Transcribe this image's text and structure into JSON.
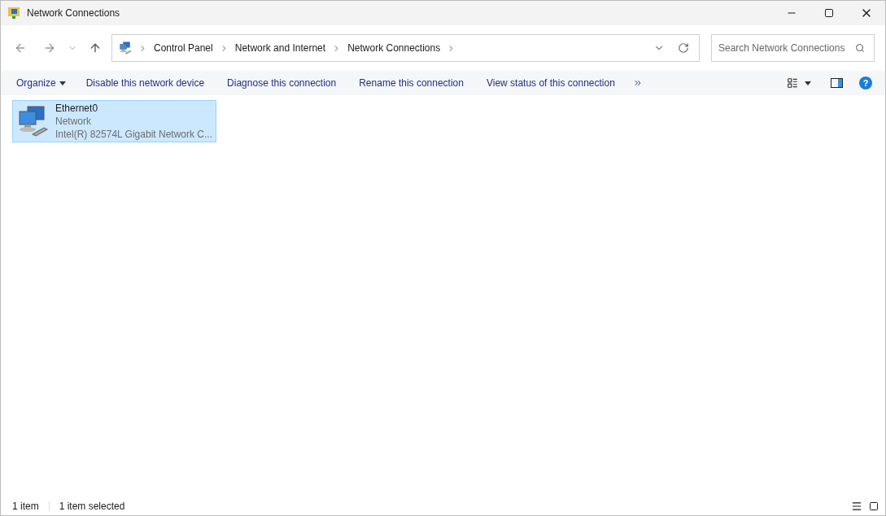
{
  "window": {
    "title": "Network Connections"
  },
  "address_bar": {
    "crumbs": [
      "Control Panel",
      "Network and Internet",
      "Network Connections"
    ]
  },
  "search": {
    "placeholder": "Search Network Connections"
  },
  "command_bar": {
    "organize": "Organize",
    "commands": [
      "Disable this network device",
      "Diagnose this connection",
      "Rename this connection",
      "View status of this connection"
    ],
    "help": "?"
  },
  "items": [
    {
      "name": "Ethernet0",
      "status": "Network",
      "device": "Intel(R) 82574L Gigabit Network C...",
      "selected": true
    }
  ],
  "status_bar": {
    "count": "1 item",
    "selection": "1 item selected"
  }
}
